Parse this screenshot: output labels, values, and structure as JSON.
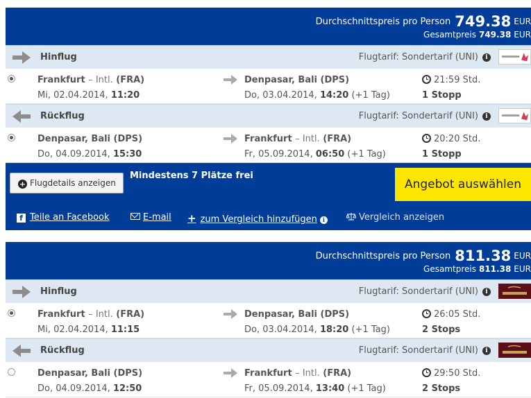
{
  "offers": [
    {
      "avg_label": "Durchschnittspreis pro Person",
      "avg_price": "749.38",
      "currency": "EUR",
      "total_label": "Gesamtpreis",
      "total_price": "749.38",
      "sections": [
        {
          "label": "Hinflug",
          "tarif": "Flugtarif: Sondertarif (UNI)",
          "airline_logo": "china-airlines-logo",
          "dep_city": "Frankfurt",
          "dep_intl": "– Intl.",
          "dep_code": "(FRA)",
          "dep_date": "Mi, 02.04.2014,",
          "dep_time": "11:20",
          "arr_city": "Denpasar, Bali (DPS)",
          "arr_date": "Do, 03.04.2014,",
          "arr_time": "14:20",
          "arr_plus": "(+1 Tag)",
          "duration": "21:59 Std.",
          "stops": "1 Stopp",
          "selected": true
        },
        {
          "label": "Rückflug",
          "tarif": "Flugtarif: Sondertarif (UNI)",
          "airline_logo": "china-airlines-logo",
          "dep_city": "Denpasar, Bali (DPS)",
          "dep_date": "Do, 04.09.2014,",
          "dep_time": "15:30",
          "arr_city": "Frankfurt",
          "arr_intl": "– Intl.",
          "arr_code": "(FRA)",
          "arr_date": "Fr, 05.09.2014,",
          "arr_time": "06:50",
          "arr_plus": "(+1 Tag)",
          "duration": "20:20 Std.",
          "stops": "1 Stopp",
          "selected": true
        }
      ],
      "details_label": "Flugdetails anzeigen",
      "seats_label": "Mindestens 7 Plätze frei",
      "select_label": "Angebot auswählen",
      "links": {
        "facebook": "Teile an Facebook",
        "email": "E-mail",
        "compare_add": "zum Vergleich hinzufügen",
        "compare_show": "Vergleich anzeigen"
      }
    },
    {
      "avg_label": "Durchschnittspreis pro Person",
      "avg_price": "811.38",
      "currency": "EUR",
      "total_label": "Gesamtpreis",
      "total_price": "811.38",
      "sections": [
        {
          "label": "Hinflug",
          "tarif": "Flugtarif: Sondertarif (UNI)",
          "airline_logo": "etihad-logo",
          "dep_city": "Frankfurt",
          "dep_intl": "– Intl.",
          "dep_code": "(FRA)",
          "dep_date": "Mi, 02.04.2014,",
          "dep_time": "11:15",
          "arr_city": "Denpasar, Bali (DPS)",
          "arr_date": "Do, 03.04.2014,",
          "arr_time": "18:20",
          "arr_plus": "(+1 Tag)",
          "duration": "26:05 Std.",
          "stops": "2 Stops",
          "selected": true
        },
        {
          "label": "Rückflug",
          "tarif": "Flugtarif: Sondertarif (UNI)",
          "airline_logo": "etihad-logo",
          "dep_city": "Denpasar, Bali (DPS)",
          "dep_date": "Do, 04.09.2014,",
          "dep_time": "12:50",
          "arr_city": "Frankfurt",
          "arr_intl": "– Intl.",
          "arr_code": "(FRA)",
          "arr_date": "Fr, 05.09.2014,",
          "arr_time": "13:40",
          "arr_plus": "(+1 Tag)",
          "duration": "29:50 Std.",
          "stops": "2 Stops",
          "selected": false
        }
      ]
    }
  ]
}
